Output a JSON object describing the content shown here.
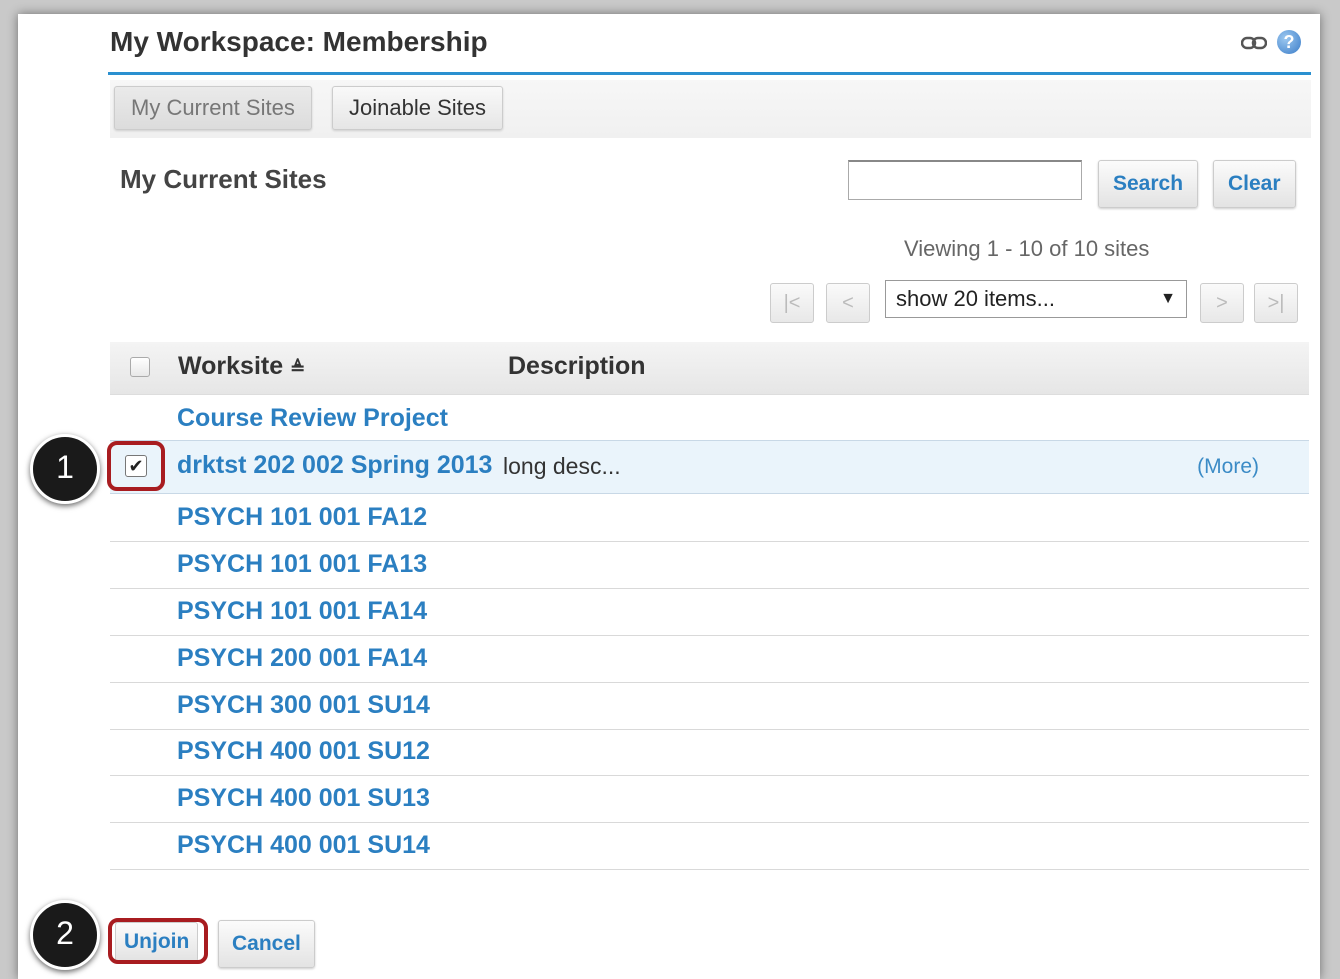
{
  "header": {
    "title": "My Workspace: Membership"
  },
  "tabs": [
    {
      "label": "My Current Sites"
    },
    {
      "label": "Joinable Sites"
    }
  ],
  "main": {
    "section_title": "My Current Sites",
    "search": {
      "placeholder": "",
      "button_label": "Search",
      "clear_label": "Clear"
    },
    "viewing": "Viewing 1 - 10 of 10 sites",
    "pager": {
      "first": "|<",
      "prev": "<",
      "next": ">",
      "last": ">|",
      "page_size": "show 20 items..."
    }
  },
  "table": {
    "columns": {
      "worksite": "Worksite",
      "sort_indicator": "≜",
      "description": "Description"
    },
    "rows": [
      {
        "name": "Course Review Project",
        "description": "",
        "more": "",
        "checked": false
      },
      {
        "name": "drktst 202 002 Spring 2013",
        "description": "long desc...",
        "more": "(More)",
        "checked": true,
        "check_mark": "✔"
      },
      {
        "name": "PSYCH 101 001 FA12"
      },
      {
        "name": "PSYCH 101 001 FA13"
      },
      {
        "name": "PSYCH 101 001 FA14"
      },
      {
        "name": "PSYCH 200 001 FA14"
      },
      {
        "name": "PSYCH 300 001 SU14"
      },
      {
        "name": "PSYCH 400 001 SU12"
      },
      {
        "name": "PSYCH 400 001 SU13"
      },
      {
        "name": "PSYCH 400 001 SU14"
      }
    ]
  },
  "footer": {
    "unjoin_label": "Unjoin",
    "cancel_label": "Cancel"
  },
  "annotations": {
    "marker_1": "1",
    "marker_2": "2"
  },
  "icons": {
    "link": "link-icon",
    "help": "help-icon",
    "help_glyph": "?",
    "select_arrow": "▼"
  },
  "colors": {
    "accent": "#2a90d0",
    "link": "#2b7fc1",
    "highlight": "#a81c20"
  }
}
